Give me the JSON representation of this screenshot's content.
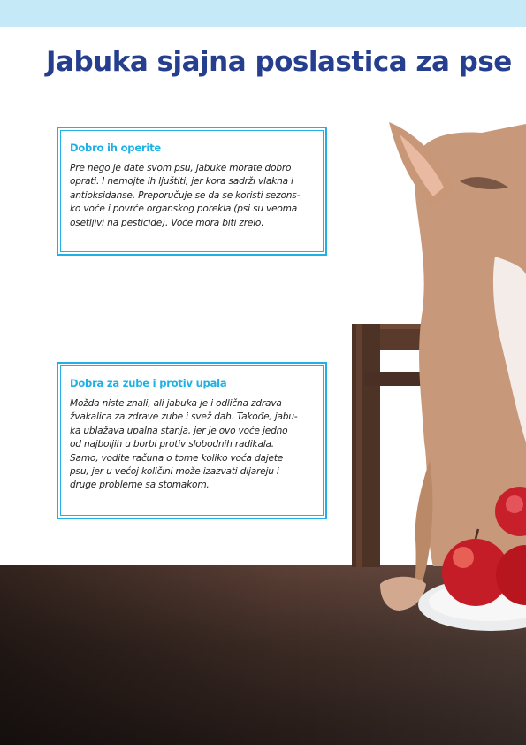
{
  "page": {
    "title": "Jabuka  sjajna poslastica za pse",
    "accent_color": "#1fb1e6",
    "title_color": "#253f8e"
  },
  "cards": [
    {
      "heading": "Dobro ih operite",
      "lines": [
        "Pre nego je date svom psu, jabuke morate dobro",
        "oprati. I nemojte ih ljuštiti, jer kora sadrži vlakna i",
        "antioksidanse. Preporučuje se da se koristi sezons-",
        "ko voće i povrće organskog porekla (psi su veoma",
        "osetljivi na pesticide). Voće mora biti zrelo."
      ]
    },
    {
      "heading": "Dobra za zube i protiv upala",
      "lines": [
        "Možda niste znali, ali jabuka je i odlična zdrava",
        "žvakalica za zdrave zube i svež dah. Takođe, jabu-",
        "ka ublažava upalna stanja, jer je ovo voće jedno",
        "od najboljih u borbi protiv slobodnih radikala.",
        "Samo, vodite računa o tome koliko voća dajete",
        "psu, jer u većoj količini može izazvati dijareju i",
        "druge probleme sa stomakom."
      ]
    }
  ]
}
